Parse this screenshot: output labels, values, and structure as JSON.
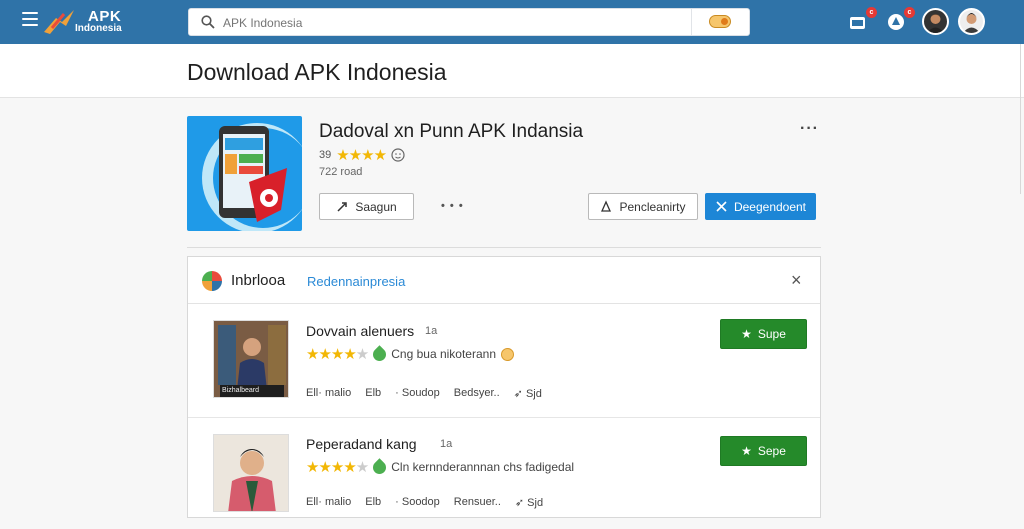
{
  "topbar": {
    "logo_line1": "APK",
    "logo_line2": "Indonesia",
    "search_placeholder": "APK Indonesia",
    "badges": [
      "c",
      "c"
    ],
    "colors": {
      "bar": "#2f73a8",
      "badge": "#e53935"
    }
  },
  "page_title": "Download APK Indonesia",
  "app": {
    "name": "Dadoval xn Punn APK Indansia",
    "rating_prefix": "39",
    "rating_stars": 4,
    "size_text": "722 road",
    "buttons": {
      "share": "Saagun",
      "dots": "• • •",
      "secondary": "Pencleanirty",
      "primary": "Deegendoent"
    },
    "more": "···"
  },
  "panel": {
    "title": "Inbrlooa",
    "subtitle": "Redennainpresia",
    "close": "×"
  },
  "list": [
    {
      "title": "Dovvain alenuers",
      "num": "1a",
      "stars": 3.5,
      "rating_text": "Cng bua nikoterann",
      "thumb_caption": "Bizhalbeard",
      "meta": [
        "Ell·  malio",
        "Elb",
        "· Soudop",
        "Bedsyer..",
        "Sjd"
      ],
      "button": "Supe"
    },
    {
      "title": "Peperadand  kang",
      "num": "1a",
      "stars": 3.5,
      "rating_text": "Cln kernnderannnan chs fadigedal",
      "meta": [
        "Ell·  malio",
        "Elb",
        "· Soodop",
        "Rensuer..",
        "Sjd"
      ],
      "button": "Sepe"
    }
  ]
}
